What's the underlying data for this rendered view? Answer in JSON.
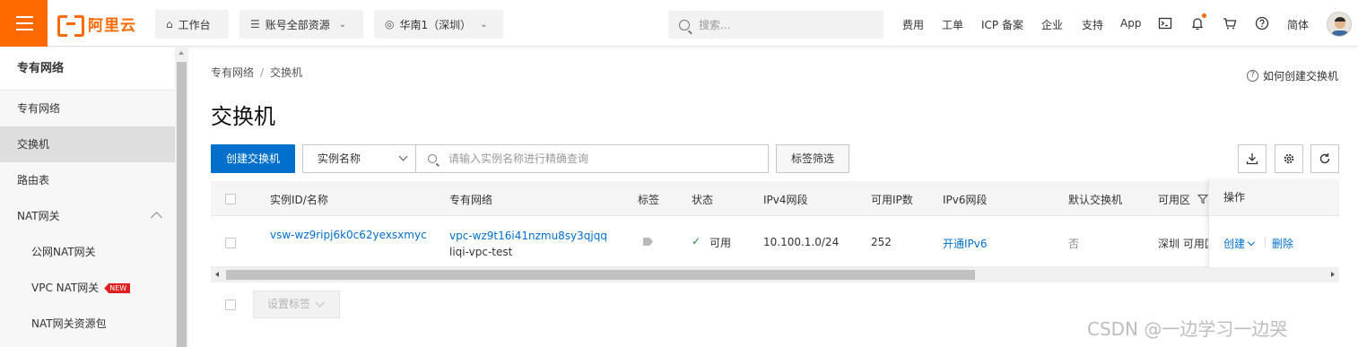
{
  "topbar": {
    "logo_text": "阿里云",
    "workbench": "工作台",
    "resources": "账号全部资源",
    "region": "华南1（深圳）",
    "search_placeholder": "搜索...",
    "links": [
      "费用",
      "工单",
      "ICP 备案",
      "企业",
      "支持",
      "App"
    ],
    "lang": "简体",
    "icons": [
      "terminal-icon",
      "bell-icon",
      "cart-icon",
      "help-icon"
    ]
  },
  "sidebar": {
    "title": "专有网络",
    "items": [
      {
        "label": "专有网络"
      },
      {
        "label": "交换机"
      },
      {
        "label": "路由表"
      },
      {
        "label": "NAT网关"
      },
      {
        "label": "公网NAT网关"
      },
      {
        "label": "VPC NAT网关",
        "tag": "NEW"
      },
      {
        "label": "NAT网关资源包"
      }
    ]
  },
  "main": {
    "breadcrumb": [
      "专有网络",
      "交换机"
    ],
    "breadcrumb_sep": "/",
    "help": "如何创建交换机",
    "title": "交换机",
    "create_button": "创建交换机",
    "filter_select": "实例名称",
    "search_placeholder": "请输入实例名称进行精确查询",
    "tag_filter": "标签筛选",
    "table": {
      "columns": [
        "实例ID/名称",
        "专有网络",
        "标签",
        "状态",
        "IPv4网段",
        "可用IP数",
        "IPv6网段",
        "默认交换机",
        "可用区",
        "操作"
      ],
      "rows": [
        {
          "id": "vsw-wz9ripj6k0c62yexsxmyc",
          "vpc_id": "vpc-wz9t16i41nzmu8sy3qjqq",
          "vpc_name": "liqi-vpc-test",
          "status": "可用",
          "ipv4": "10.100.1.0/24",
          "available_ips": "252",
          "ipv6": "开通IPv6",
          "default": "否",
          "zone": "深圳 可用区",
          "op_create": "创建",
          "op_delete": "删除"
        }
      ]
    },
    "set_tags": "设置标签"
  },
  "watermark": "CSDN @一边学习一边哭",
  "colors": {
    "brand": "#ff6a00",
    "primary": "#0070cc",
    "success": "#1e8e3e"
  }
}
